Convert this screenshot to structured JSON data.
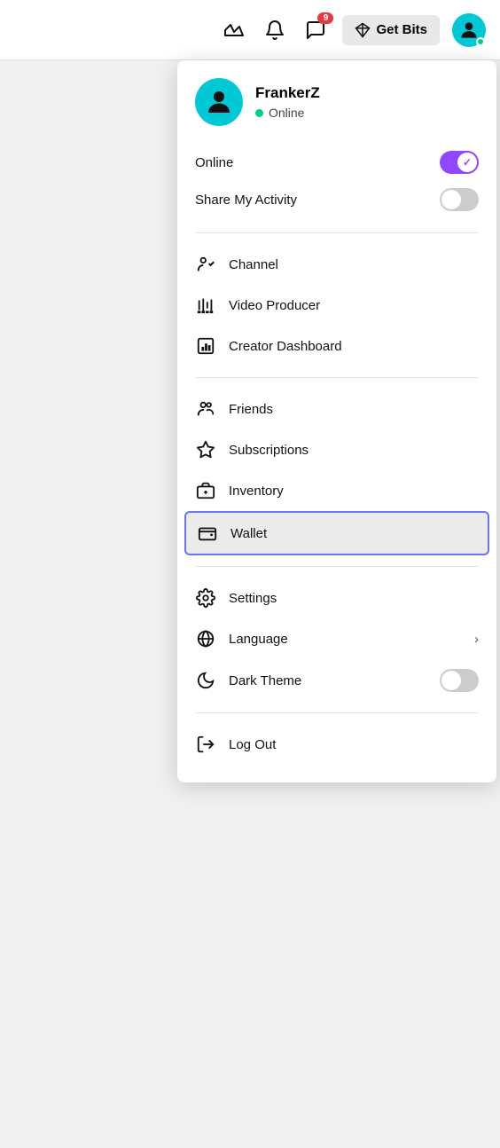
{
  "topbar": {
    "get_bits_label": "Get Bits",
    "notification_count": "9"
  },
  "profile": {
    "username": "FrankerZ",
    "status": "Online",
    "online_dot_color": "#00d084"
  },
  "toggles": {
    "online_label": "Online",
    "online_state": "on",
    "share_activity_label": "Share My Activity",
    "share_activity_state": "off"
  },
  "menu_sections": [
    {
      "items": [
        {
          "id": "channel",
          "label": "Channel",
          "icon": "channel-icon",
          "has_chevron": false,
          "active": false
        },
        {
          "id": "video-producer",
          "label": "Video Producer",
          "icon": "video-producer-icon",
          "has_chevron": false,
          "active": false
        },
        {
          "id": "creator-dashboard",
          "label": "Creator Dashboard",
          "icon": "creator-dashboard-icon",
          "has_chevron": false,
          "active": false
        }
      ]
    },
    {
      "items": [
        {
          "id": "friends",
          "label": "Friends",
          "icon": "friends-icon",
          "has_chevron": false,
          "active": false
        },
        {
          "id": "subscriptions",
          "label": "Subscriptions",
          "icon": "subscriptions-icon",
          "has_chevron": false,
          "active": false
        },
        {
          "id": "inventory",
          "label": "Inventory",
          "icon": "inventory-icon",
          "has_chevron": false,
          "active": false
        },
        {
          "id": "wallet",
          "label": "Wallet",
          "icon": "wallet-icon",
          "has_chevron": false,
          "active": true
        }
      ]
    },
    {
      "items": [
        {
          "id": "settings",
          "label": "Settings",
          "icon": "settings-icon",
          "has_chevron": false,
          "active": false
        },
        {
          "id": "language",
          "label": "Language",
          "icon": "language-icon",
          "has_chevron": true,
          "active": false
        },
        {
          "id": "dark-theme",
          "label": "Dark Theme",
          "icon": "dark-theme-icon",
          "has_chevron": false,
          "active": false,
          "toggle": "off"
        }
      ]
    },
    {
      "items": [
        {
          "id": "log-out",
          "label": "Log Out",
          "icon": "logout-icon",
          "has_chevron": false,
          "active": false
        }
      ]
    }
  ]
}
